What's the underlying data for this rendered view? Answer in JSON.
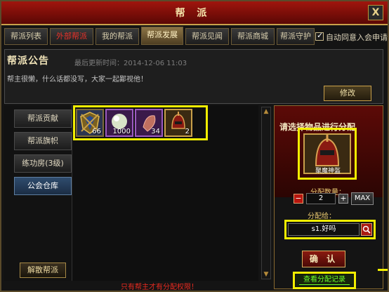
{
  "window": {
    "title": "帮 派",
    "close_label": "X"
  },
  "tabs": [
    {
      "label": "帮派列表"
    },
    {
      "label": "外部帮派"
    },
    {
      "label": "我的帮派"
    },
    {
      "label": "帮派发展"
    },
    {
      "label": "帮派见闻"
    },
    {
      "label": "帮派商城"
    },
    {
      "label": "帮派守护"
    }
  ],
  "active_tab": "帮派发展",
  "auto_accept": {
    "label": "自动同意入会申请",
    "checked": true,
    "check_glyph": "✓"
  },
  "notice": {
    "title": "帮派公告",
    "updated": "最后更新时间：2014-12-06 11:03",
    "body": "帮主很懒，什么话都没写，大家一起鄙视他！",
    "edit_label": "修改"
  },
  "sidebar": {
    "items": [
      {
        "label": "帮派贡献"
      },
      {
        "label": "帮派旗帜"
      },
      {
        "label": "练功房(3级)"
      },
      {
        "label": "公会仓库"
      }
    ],
    "active": "公会仓库",
    "disband_label": "解散帮派"
  },
  "storage": {
    "items": [
      {
        "name": "shield-emblem",
        "qty": "66"
      },
      {
        "name": "pearl-orb",
        "qty": "1000"
      },
      {
        "name": "red-gem",
        "qty": "34"
      },
      {
        "name": "red-helmet",
        "qty": "2"
      }
    ],
    "scroll_up_glyph": "▲",
    "scroll_down_glyph": "▼"
  },
  "warning": "只有帮主才有分配权限！",
  "distribute": {
    "title": "请选择物品进行分配",
    "selected_label": "聚魔神盔",
    "qty_label": "分配数量：",
    "qty_value": "2",
    "minus_label": "−",
    "plus_label": "+",
    "max_label": "MAX",
    "to_label": "分配给：",
    "recipient": "s1.好吗",
    "confirm_label": "确 认",
    "records_label": "查看分配记录"
  },
  "colors": {
    "highlight": "#f2ee00",
    "title_bar": "#a0150d",
    "records_link": "#6cff2a",
    "warning": "#e82a20"
  }
}
